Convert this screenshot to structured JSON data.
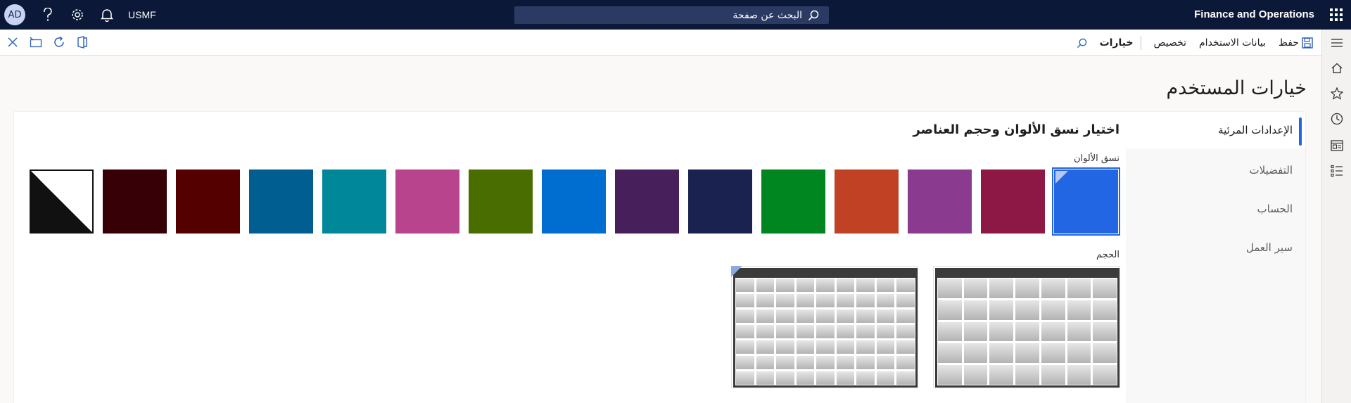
{
  "topbar": {
    "avatar_initials": "AD",
    "company": "USMF",
    "search_placeholder": "البحث عن صفحة",
    "app_name": "Finance and Operations",
    "icons": [
      "help-icon",
      "settings-icon",
      "bell-icon",
      "search-icon",
      "waffle-icon"
    ]
  },
  "actionbar": {
    "save_label": "حفظ",
    "usage_data_label": "بيانات الاستخدام",
    "personalize_label": "تخصيص",
    "options_label": "خيارات",
    "left_icons": [
      "close-icon",
      "open-new-window-icon",
      "refresh-icon",
      "office-icon"
    ]
  },
  "page": {
    "title": "خيارات المستخدم"
  },
  "tabs": [
    {
      "label": "الإعدادات المرئية",
      "active": true
    },
    {
      "label": "التفضيلات",
      "active": false
    },
    {
      "label": "الحساب",
      "active": false
    },
    {
      "label": "سير العمل",
      "active": false
    }
  ],
  "visual": {
    "section_title": "اختيار نسق الألوان وحجم العناصر",
    "color_label": "نسق الألوان",
    "size_label": "الحجم",
    "swatches": [
      {
        "color": "#2266e3",
        "selected": true
      },
      {
        "color": "#8e1845",
        "selected": false
      },
      {
        "color": "#8a3b8f",
        "selected": false
      },
      {
        "color": "#c04123",
        "selected": false
      },
      {
        "color": "#008621",
        "selected": false
      },
      {
        "color": "#1a2350",
        "selected": false
      },
      {
        "color": "#471f5a",
        "selected": false
      },
      {
        "color": "#006dd1",
        "selected": false
      },
      {
        "color": "#4a6d00",
        "selected": false
      },
      {
        "color": "#b8448d",
        "selected": false
      },
      {
        "color": "#00889a",
        "selected": false
      },
      {
        "color": "#005e91",
        "selected": false
      },
      {
        "color": "#540000",
        "selected": false
      },
      {
        "color": "#360006",
        "selected": false
      },
      {
        "color": "high-contrast",
        "selected": false
      }
    ],
    "sizes": [
      {
        "name": "large",
        "columns": 7,
        "rows": 5,
        "selected": false
      },
      {
        "name": "compact",
        "columns": 9,
        "rows": 7,
        "selected": true
      }
    ]
  },
  "rail": {
    "icons": [
      "hamburger-icon",
      "home-icon",
      "star-icon",
      "clock-icon",
      "workspace-icon",
      "list-icon"
    ]
  }
}
